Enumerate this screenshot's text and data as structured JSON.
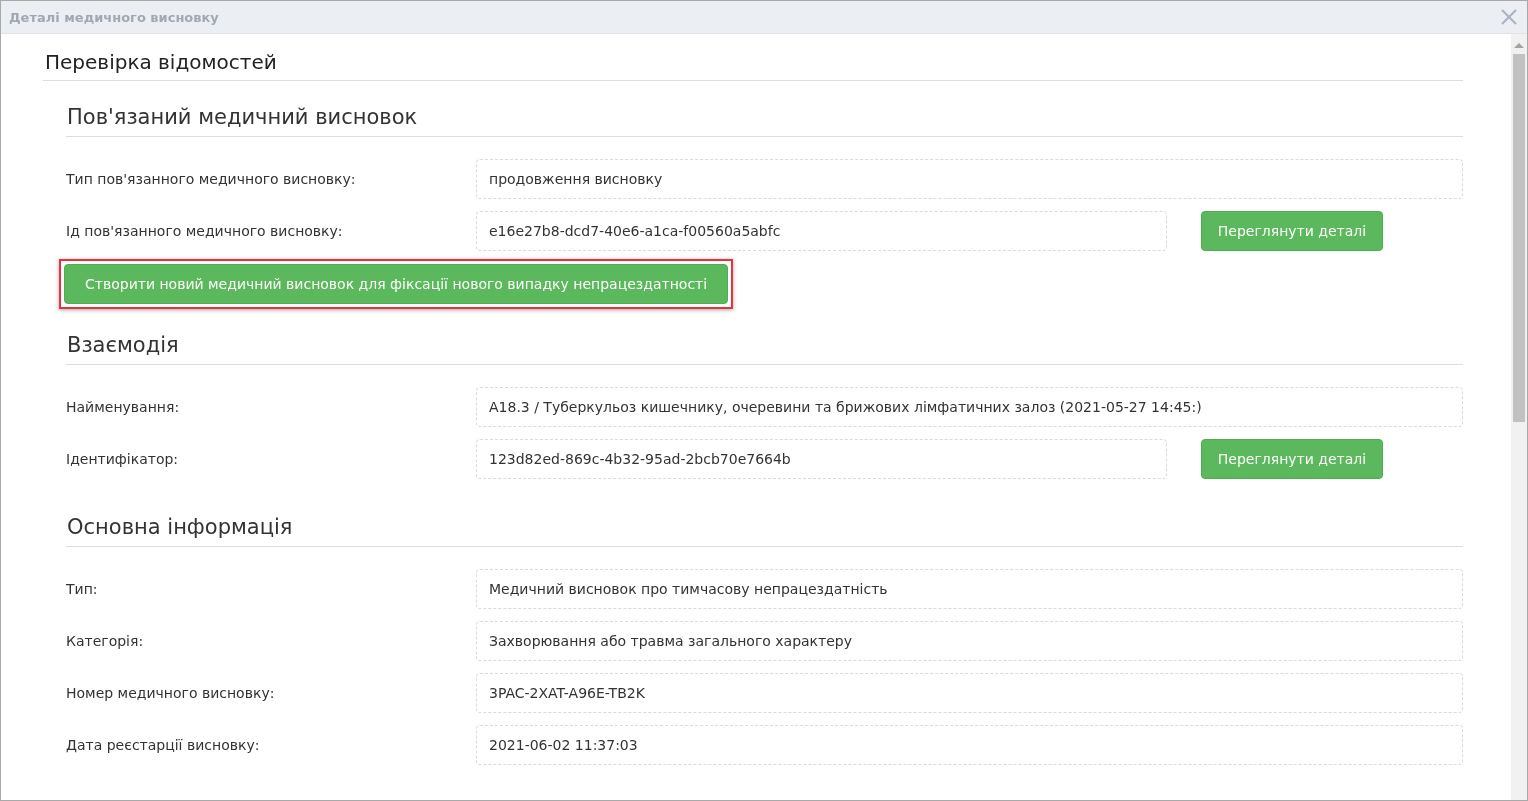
{
  "window": {
    "title": "Деталі медичного висновку"
  },
  "page_title": "Перевірка відомостей",
  "sections": [
    {
      "heading": "Пов'язаний медичний висновок",
      "rows": [
        {
          "label": "Тип пов'язанного медичного висновку:",
          "value": "продовження висновку"
        },
        {
          "label": "Ід пов'язанного медичного висновку:",
          "value": "e16e27b8-dcd7-40e6-a1ca-f00560a5abfc",
          "button": "Переглянути деталі"
        }
      ],
      "action": {
        "label": "Створити новий медичний висновок для фіксації нового випадку непрацездатності",
        "highlighted": true
      }
    },
    {
      "heading": "Взаємодія",
      "rows": [
        {
          "label": "Найменування:",
          "value": "A18.3 / Туберкульоз кишечнику, очеревини та брижових лімфатичних залоз (2021-05-27 14:45:)"
        },
        {
          "label": "Ідентифікатор:",
          "value": "123d82ed-869c-4b32-95ad-2bcb70e7664b",
          "button": "Переглянути деталі"
        }
      ]
    },
    {
      "heading": "Основна інформація",
      "rows": [
        {
          "label": "Тип:",
          "value": "Медичний висновок про тимчасову непрацездатність"
        },
        {
          "label": "Категорія:",
          "value": "Захворювання або травма загального характеру"
        },
        {
          "label": "Номер медичного висновку:",
          "value": "3PAC-2XAT-A96E-TB2K"
        },
        {
          "label": "Дата реєстарції висновку:",
          "value": "2021-06-02 11:37:03"
        }
      ]
    }
  ]
}
